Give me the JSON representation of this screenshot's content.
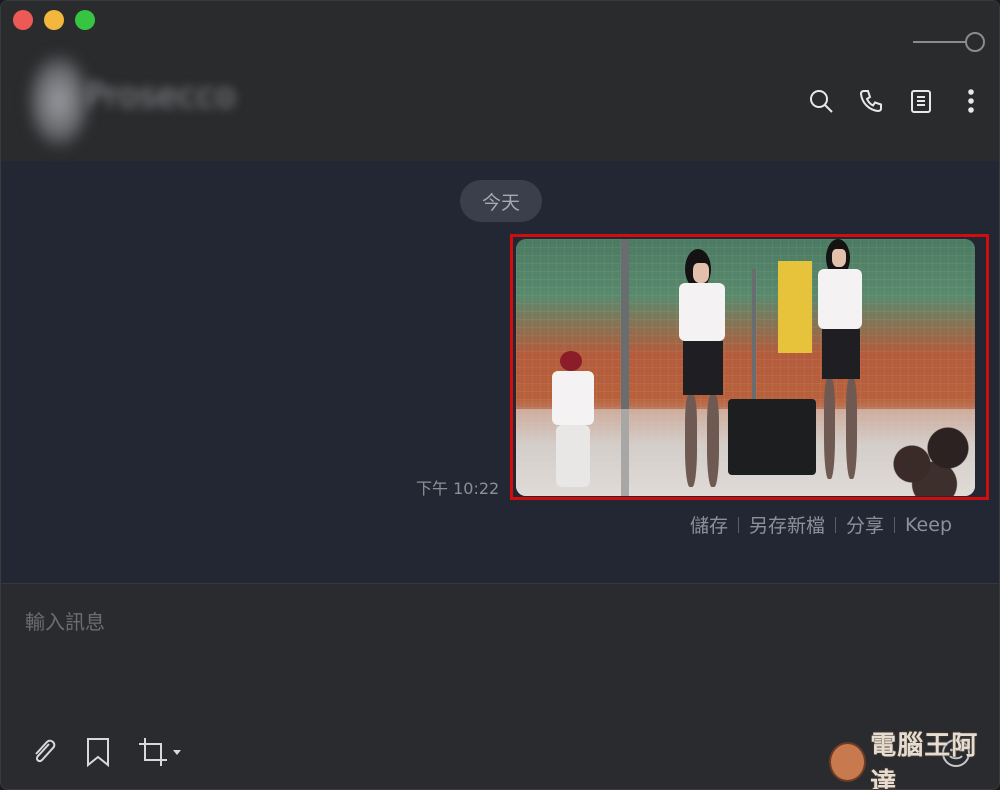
{
  "header": {
    "contact_name": "Prosecco"
  },
  "chat": {
    "date_label": "今天",
    "message_time": "下午 10:22",
    "actions": [
      "儲存",
      "另存新檔",
      "分享",
      "Keep"
    ]
  },
  "composer": {
    "placeholder": "輸入訊息"
  },
  "watermark": {
    "text": "電腦王阿達"
  },
  "colors": {
    "chat_bg": "#232733",
    "header_bg": "#2a2b2d",
    "highlight_border": "#d10d0d",
    "date_pill": "#3a3f4b"
  },
  "icons": {
    "header": [
      "search-icon",
      "phone-icon",
      "notes-icon",
      "more-vertical-icon"
    ],
    "toolbar": [
      "paperclip-icon",
      "bookmark-icon",
      "screenshot-crop-icon"
    ],
    "emoji": "emoji-icon"
  }
}
